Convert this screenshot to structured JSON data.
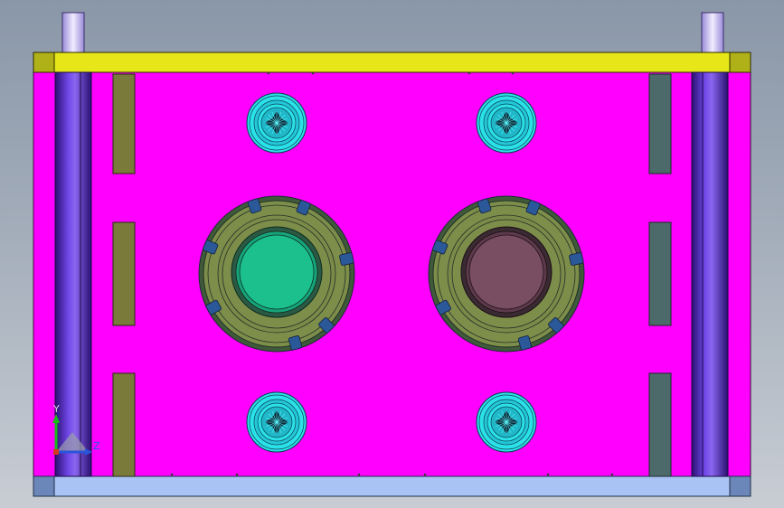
{
  "viewport": {
    "background_top": "#8a97a8",
    "background_bottom": "#c8cdd4"
  },
  "colors": {
    "plate": "#ff00ff",
    "top_plate": "#e6e619",
    "bottom_plate": "#a9c3f5",
    "corner_top": "#b0b018",
    "corner_bottom": "#6b86b8",
    "guide_pillar": "#5a2cc9",
    "support_olive": "#7a7a3a",
    "support_gray": "#4d6a6a",
    "screw_cyan": "#2be1e8",
    "bushing_olive": "#7d8e4a",
    "cavity_green": "#1bc08c",
    "cavity_maroon": "#7a4e62"
  },
  "parts": {
    "top_plate": "top-clamp-plate",
    "bottom_plate": "bottom-clamp-plate",
    "cavity_left": "cavity-insert-green",
    "cavity_right": "cavity-insert-maroon",
    "screws": [
      "socket-head-screw",
      "socket-head-screw",
      "socket-head-screw",
      "socket-head-screw"
    ]
  },
  "triad": {
    "y_label": "Y",
    "z_label": "Z",
    "x_color": "#d23a1e",
    "y_color": "#18b918",
    "z_color": "#2a55d9"
  }
}
